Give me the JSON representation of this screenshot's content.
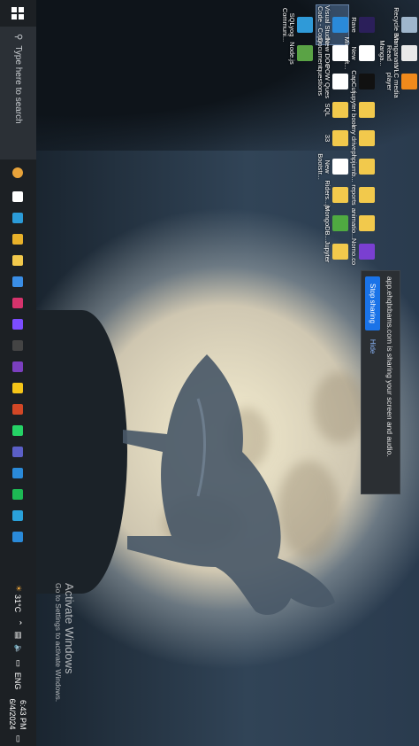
{
  "desktop_icons": [
    {
      "label": "Recycle Bin",
      "icon": "recycle-bin-icon",
      "color": "#9fb6cc"
    },
    {
      "label": "Manganato - Read Manga...",
      "icon": "manga-icon",
      "color": "#e9e9e9"
    },
    {
      "label": "VLC media player",
      "icon": "vlc-icon",
      "color": "#f08a1c"
    },
    {
      "label": "Rave",
      "icon": "rave-icon",
      "color": "#2b1f5a"
    },
    {
      "label": "Visual Studio Code - Copy",
      "icon": "vscode-icon",
      "color": "#2a8ad9"
    },
    {
      "label": "SQLyog Communi...",
      "icon": "sqlyog-icon",
      "color": "#2f9ad8"
    },
    {
      "label": "New Microsoft...",
      "icon": "word-doc-icon",
      "color": "#ffffff"
    },
    {
      "label": "New DOC Document",
      "icon": "word-doc-icon",
      "color": "#ffffff"
    },
    {
      "label": "Node.js",
      "icon": "nodejs-icon",
      "color": "#5aa345"
    },
    {
      "label": "CapCut",
      "icon": "capcut-icon",
      "color": "#111111"
    },
    {
      "label": "POW Ques questions",
      "icon": "document-icon",
      "color": "#ffffff"
    },
    {
      "label": "jupyter book",
      "icon": "folder-icon",
      "color": "#f2c94c"
    },
    {
      "label": "SQL",
      "icon": "folder-icon",
      "color": "#f2c94c"
    },
    {
      "label": "my drive",
      "icon": "folder-icon",
      "color": "#f2c94c"
    },
    {
      "label": "33",
      "icon": "folder-icon",
      "color": "#f2c94c"
    },
    {
      "label": "phpjumb...",
      "icon": "folder-icon",
      "color": "#f2c94c"
    },
    {
      "label": "New Bootstr...",
      "icon": "document-icon",
      "color": "#ffffff"
    },
    {
      "label": "reports",
      "icon": "folder-icon",
      "color": "#f2c94c"
    },
    {
      "label": "Riders...js",
      "icon": "folder-icon",
      "color": "#f2c94c"
    },
    {
      "label": "animatio...",
      "icon": "folder-icon",
      "color": "#f2c94c"
    },
    {
      "label": "MongoDB...",
      "icon": "mongodb-icon",
      "color": "#4faa41"
    },
    {
      "label": "Nomo.co",
      "icon": "app-icon",
      "color": "#7a3fd1"
    },
    {
      "label": "Jupyter",
      "icon": "folder-icon",
      "color": "#f2c94c"
    }
  ],
  "share_bar": {
    "message": "app.ehqlxbams.com is sharing your screen and audio.",
    "stop_label": "Stop sharing",
    "hide_label": "Hide"
  },
  "watermark": {
    "title": "Activate Windows",
    "subtitle": "Go to Settings to activate Windows."
  },
  "taskbar": {
    "search_placeholder": "Type here to search",
    "apps": [
      {
        "name": "task-view-icon",
        "color": "#ffffff"
      },
      {
        "name": "edge-icon",
        "color": "#2b9bd8"
      },
      {
        "name": "chrome-icon",
        "color": "#e8b12a"
      },
      {
        "name": "file-explorer-icon",
        "color": "#f2c94c"
      },
      {
        "name": "store-icon",
        "color": "#3a8ee6"
      },
      {
        "name": "instagram-icon",
        "color": "#d6336c"
      },
      {
        "name": "notepad-icon",
        "color": "#7c4dff"
      },
      {
        "name": "app-icon",
        "color": "#444444"
      },
      {
        "name": "onenote-icon",
        "color": "#7b3fbf"
      },
      {
        "name": "sticky-notes-icon",
        "color": "#f5c518"
      },
      {
        "name": "powerpoint-icon",
        "color": "#d24726"
      },
      {
        "name": "whatsapp-icon",
        "color": "#25d366"
      },
      {
        "name": "teams-icon",
        "color": "#5b5fc7"
      },
      {
        "name": "app-icon",
        "color": "#2a8ad9"
      },
      {
        "name": "spotify-icon",
        "color": "#1db954"
      },
      {
        "name": "telegram-icon",
        "color": "#2aa1da"
      },
      {
        "name": "vscode-icon",
        "color": "#2a8ad9"
      }
    ],
    "weather": "31°C",
    "language": "ENG",
    "time": "6:43 PM",
    "date": "6/4/2024"
  }
}
